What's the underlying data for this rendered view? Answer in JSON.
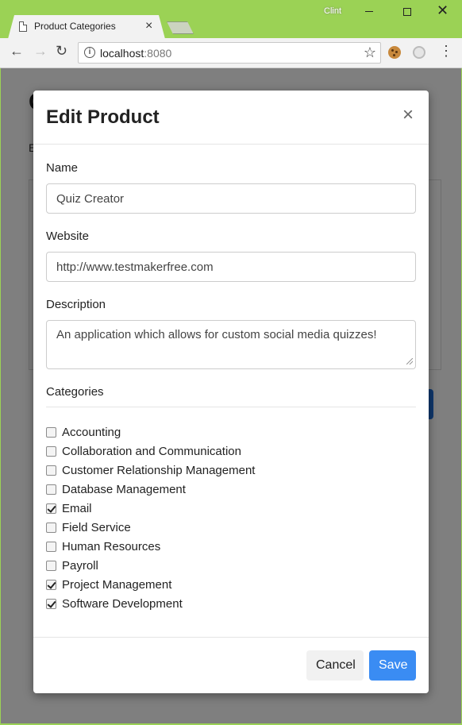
{
  "browser": {
    "tab_title": "Product Categories",
    "tab_close": "×",
    "user_name": "Clint",
    "url_host": "localhost",
    "url_port": ":8080",
    "icons": [
      "page-icon",
      "back-arrow-icon",
      "forward-arrow-icon",
      "reload-icon",
      "info-icon",
      "star-icon",
      "cookie-extension-icon",
      "extension-icon",
      "menu-icon"
    ]
  },
  "modal": {
    "title": "Edit Product",
    "close": "×",
    "name_label": "Name",
    "name_value": "Quiz Creator",
    "website_label": "Website",
    "website_value": "http://www.testmakerfree.com",
    "description_label": "Description",
    "description_value": "An application which allows for custom social media quizzes!",
    "categories_label": "Categories",
    "categories": [
      {
        "label": "Accounting",
        "checked": false
      },
      {
        "label": "Collaboration and Communication",
        "checked": false
      },
      {
        "label": "Customer Relationship Management",
        "checked": false
      },
      {
        "label": "Database Management",
        "checked": false
      },
      {
        "label": "Email",
        "checked": true
      },
      {
        "label": "Field Service",
        "checked": false
      },
      {
        "label": "Human Resources",
        "checked": false
      },
      {
        "label": "Payroll",
        "checked": false
      },
      {
        "label": "Project Management",
        "checked": true
      },
      {
        "label": "Software Development",
        "checked": true
      }
    ],
    "cancel_label": "Cancel",
    "save_label": "Save"
  },
  "colors": {
    "chrome_frame": "#9bd255",
    "primary_button": "#3a8cf3"
  }
}
